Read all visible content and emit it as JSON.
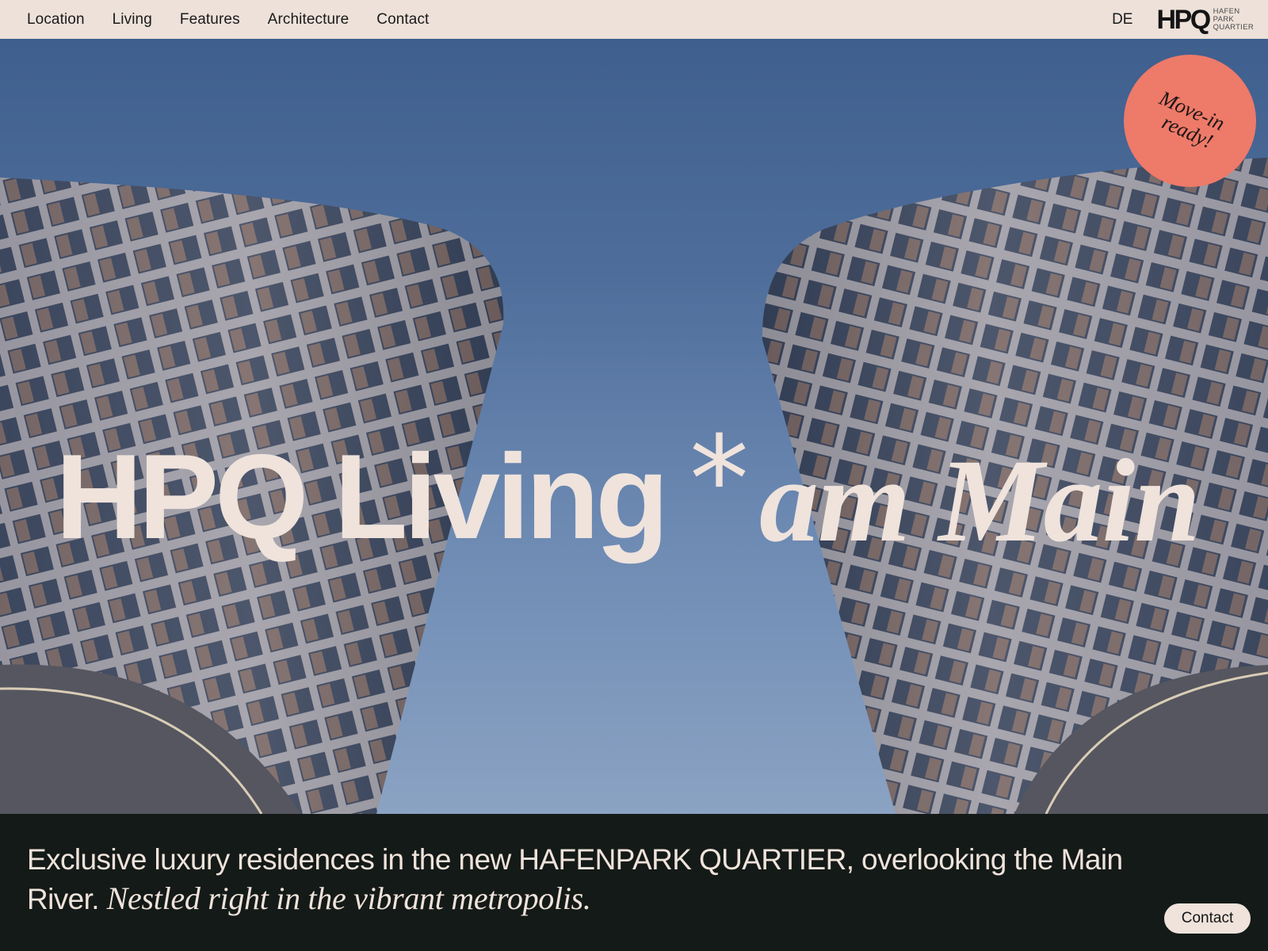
{
  "nav": {
    "links": [
      "Location",
      "Living",
      "Features",
      "Architecture",
      "Contact"
    ],
    "language": "DE",
    "logo": {
      "mark": "HPQ",
      "line1": "HAFEN",
      "line2": "PARK",
      "line3": "QUARTIER"
    }
  },
  "hero": {
    "title_main": "HPQ Living",
    "title_star": "*",
    "title_accent": "am Main",
    "badge": {
      "line1": "Move-in",
      "line2": "ready!"
    }
  },
  "intro": {
    "text": "Exclusive luxury residences in the new HAFENPARK QUARTIER, overlooking the Main River.",
    "text_italic": "Nestled right in the vibrant metropolis."
  },
  "contact_button": "Contact",
  "colors": {
    "nav_bg": "#ede1d9",
    "dark_band": "#141a17",
    "text_light": "#efe3dc",
    "badge": "#ee7a69",
    "sky_top": "#3f5f8e",
    "sky_bottom": "#8ba3c3"
  }
}
